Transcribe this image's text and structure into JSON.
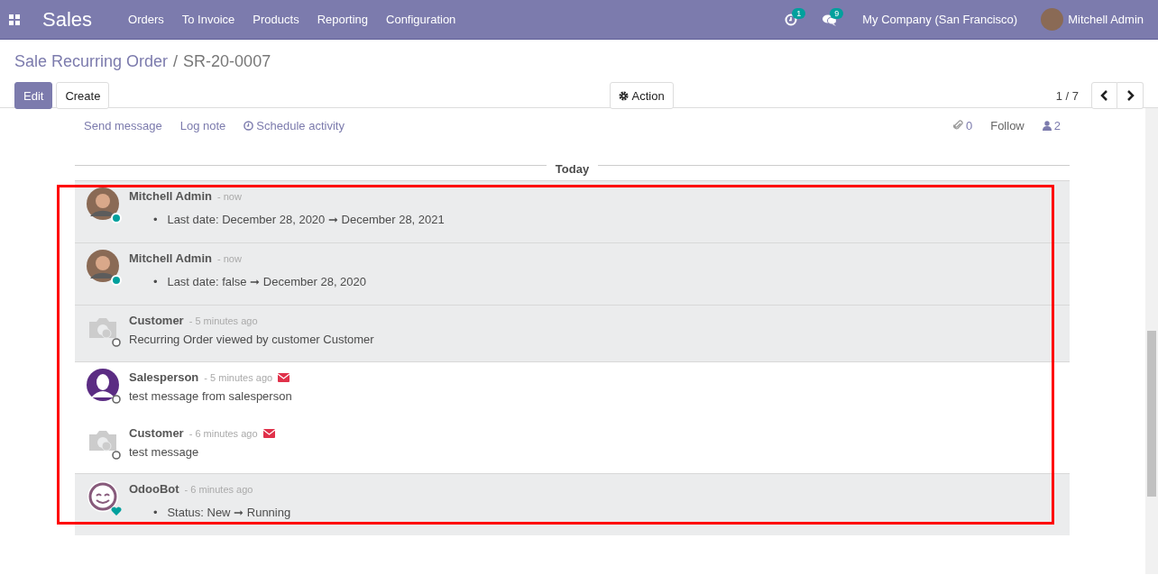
{
  "navbar": {
    "app_name": "Sales",
    "menu": [
      "Orders",
      "To Invoice",
      "Products",
      "Reporting",
      "Configuration"
    ],
    "activity_count": "1",
    "message_count": "9",
    "company": "My Company (San Francisco)",
    "user": "Mitchell Admin"
  },
  "breadcrumb": {
    "parent": "Sale Recurring Order",
    "separator": "/",
    "current": "SR-20-0007"
  },
  "buttons": {
    "edit": "Edit",
    "create": "Create",
    "action": "Action"
  },
  "pager": {
    "value": "1 / 7"
  },
  "chatter": {
    "send_message": "Send message",
    "log_note": "Log note",
    "schedule_activity": "Schedule activity",
    "attachments": "0",
    "follow": "Follow",
    "followers": "2",
    "date_separator": "Today",
    "messages": [
      {
        "author": "Mitchell Admin",
        "time": "- now",
        "kind": "tracking",
        "avatar": {
          "kind": "photo"
        },
        "presence": {
          "kind": "online"
        },
        "via_email": false,
        "changes": [
          {
            "bullet": "•",
            "field": "Last date:",
            "old": "December 28, 2020",
            "arrow": "➞",
            "new": "December 28, 2021"
          }
        ]
      },
      {
        "author": "Mitchell Admin",
        "time": "- now",
        "kind": "tracking",
        "avatar": {
          "kind": "photo"
        },
        "presence": {
          "kind": "online"
        },
        "via_email": false,
        "changes": [
          {
            "bullet": "•",
            "field": "Last date:",
            "old": "false",
            "arrow": "➞",
            "new": "December 28, 2020"
          }
        ]
      },
      {
        "author": "Customer",
        "time": "- 5 minutes ago",
        "kind": "notification",
        "avatar": {
          "kind": "placeholder"
        },
        "presence": {
          "kind": "offline"
        },
        "via_email": false,
        "body": "Recurring Order viewed by customer Customer"
      },
      {
        "author": "Salesperson",
        "time": "- 5 minutes ago",
        "kind": "message",
        "avatar": {
          "kind": "silhouette"
        },
        "presence": {
          "kind": "offline"
        },
        "via_email": true,
        "body": "test message from salesperson"
      },
      {
        "author": "Customer",
        "time": "- 6 minutes ago",
        "kind": "message",
        "avatar": {
          "kind": "placeholder"
        },
        "presence": {
          "kind": "offline"
        },
        "via_email": true,
        "body": "test message"
      },
      {
        "author": "OdooBot",
        "time": "- 6 minutes ago",
        "kind": "tracking",
        "avatar": {
          "kind": "bot"
        },
        "presence": {
          "kind": "bot"
        },
        "via_email": false,
        "changes": [
          {
            "bullet": "•",
            "field": "Status:",
            "old": "New",
            "arrow": "➞",
            "new": "Running"
          }
        ]
      }
    ]
  }
}
